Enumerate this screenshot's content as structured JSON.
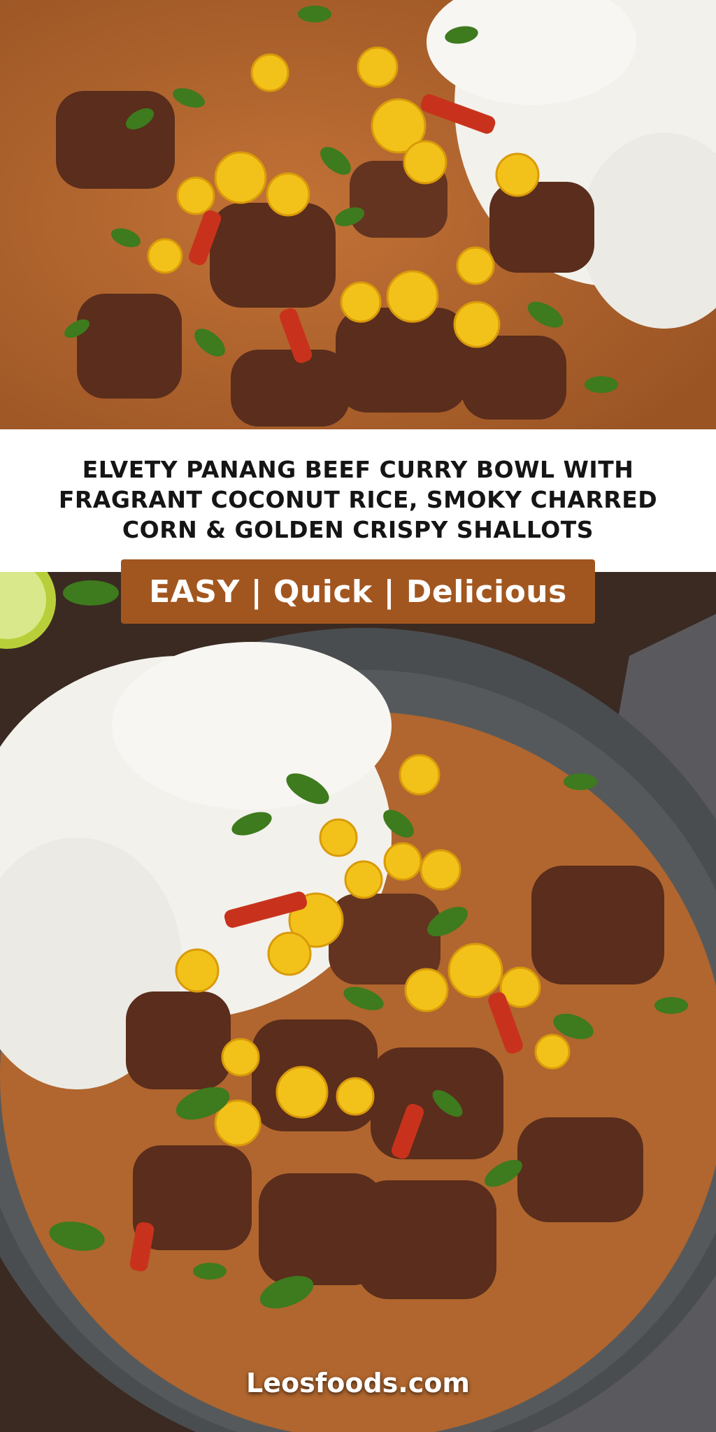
{
  "title": "ELVETY PANANG BEEF CURRY BOWL WITH FRAGRANT COCONUT RICE, SMOKY CHARRED CORN & GOLDEN CRISPY SHALLOTS",
  "tagline": "EASY | Quick | Delicious",
  "site": "Leosfoods.com",
  "colors": {
    "badge": "#a2561f",
    "curry": "#b0662e",
    "beef": "#5a2d1c",
    "rice": "#f3f1ec",
    "corn": "#f2c21a",
    "cilantro": "#3e7a1e",
    "pepper": "#c8321c",
    "bowl": "#4a4d4f"
  }
}
